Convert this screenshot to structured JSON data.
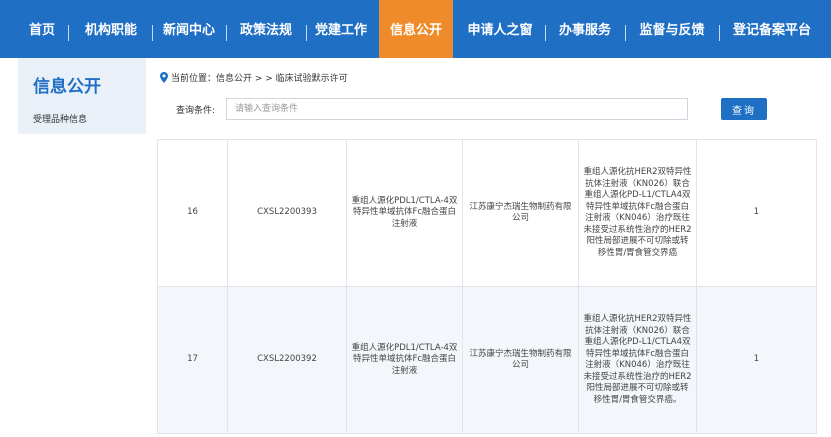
{
  "nav": {
    "items": [
      {
        "label": "首页",
        "active": false
      },
      {
        "label": "机构职能",
        "active": false
      },
      {
        "label": "新闻中心",
        "active": false
      },
      {
        "label": "政策法规",
        "active": false
      },
      {
        "label": "党建工作",
        "active": false
      },
      {
        "label": "信息公开",
        "active": true
      },
      {
        "label": "申请人之窗",
        "active": false
      },
      {
        "label": "办事服务",
        "active": false
      },
      {
        "label": "监督与反馈",
        "active": false
      },
      {
        "label": "登记备案平台",
        "active": false
      }
    ]
  },
  "sidebar": {
    "title": "信息公开",
    "items": [
      {
        "label": "受理品种信息"
      }
    ]
  },
  "breadcrumb": {
    "prefix": "当前位置：信息公开 > > 临床试验默示许可"
  },
  "search": {
    "label": "查询条件:",
    "placeholder": "请输入查询条件",
    "value": "",
    "button_label": "查询"
  },
  "table": {
    "rows": [
      {
        "no": "16",
        "acceptance_no": "CXSL2200393",
        "drug_name": "重组人源化PDL1/CTLA-4双特异性单域抗体Fc融合蛋白注射液",
        "applicant": "江苏康宁杰瑞生物制药有限公司",
        "indication": "重组人源化抗HER2双特异性抗体注射液（KN026）联合重组人源化PD-L1/CTLA4双特异性单域抗体Fc融合蛋白注射液（KN046）治疗既往未接受过系统性治疗的HER2阳性局部进展不可切除或转移性胃/胃食管交界癌",
        "count": "1"
      },
      {
        "no": "17",
        "acceptance_no": "CXSL2200392",
        "drug_name": "重组人源化PDL1/CTLA-4双特异性单域抗体Fc融合蛋白注射液",
        "applicant": "江苏康宁杰瑞生物制药有限公司",
        "indication": "重组人源化抗HER2双特异性抗体注射液（KN026）联合重组人源化PD-L1/CTLA4双特异性单域抗体Fc融合蛋白注射液（KN046）治疗既往未接受过系统性治疗的HER2阳性局部进展不可切除或转移性胃/胃食管交界癌。",
        "count": "1"
      }
    ]
  },
  "colors": {
    "nav_bg": "#1f6fc5",
    "nav_active": "#f08b2b",
    "accent": "#1f6fc5",
    "sidebar_bg": "#e9f0f8"
  }
}
